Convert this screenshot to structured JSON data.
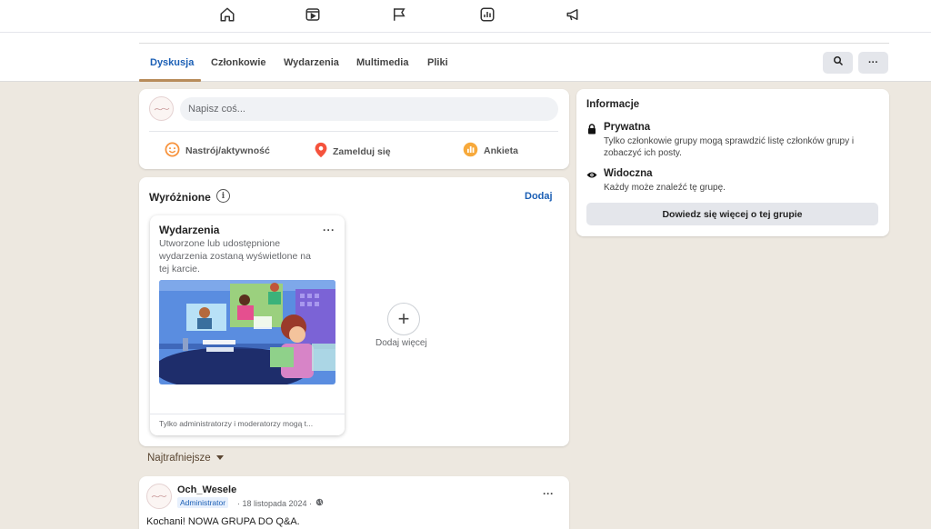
{
  "nav": {
    "icons": [
      "home-icon",
      "video-icon",
      "flag-icon",
      "chart-icon",
      "megaphone-icon"
    ]
  },
  "tabs": [
    {
      "label": "Dyskusja",
      "active": true
    },
    {
      "label": "Członkowie",
      "active": false
    },
    {
      "label": "Wydarzenia",
      "active": false
    },
    {
      "label": "Multimedia",
      "active": false
    },
    {
      "label": "Pliki",
      "active": false
    }
  ],
  "header_actions": {
    "search_icon": "search-icon",
    "more_label": "···"
  },
  "composer": {
    "placeholder": "Napisz coś...",
    "actions": [
      {
        "label": "Nastrój/aktywność",
        "icon": "smiley-icon",
        "color": "#f7923b"
      },
      {
        "label": "Zamelduj się",
        "icon": "location-pin-icon",
        "color": "#f5533d"
      },
      {
        "label": "Ankieta",
        "icon": "poll-icon",
        "color": "#f7b928"
      }
    ]
  },
  "featured": {
    "title": "Wyróżnione",
    "info_glyph": "i",
    "add_label": "Dodaj",
    "card": {
      "title": "Wydarzenia",
      "more_label": "···",
      "description": "Utworzone lub udostępnione wydarzenia zostaną wyświetlone na tej karcie.",
      "footer": "Tylko administratorzy i moderatorzy mogą t..."
    },
    "add_more_glyph": "+",
    "add_more_label": "Dodaj więcej"
  },
  "sort": {
    "label": "Najtrafniejsze"
  },
  "post": {
    "author": "Och_Wesele",
    "badge": "Administrator",
    "date": "· 18 listopada 2024 ·",
    "more_label": "···",
    "text": "Kochani! NOWA GRUPA DO Q&A."
  },
  "info": {
    "title": "Informacje",
    "items": [
      {
        "icon": "lock-icon",
        "title": "Prywatna",
        "description": "Tylko członkowie grupy mogą sprawdzić listę członków grupy i zobaczyć ich posty."
      },
      {
        "icon": "eye-icon",
        "title": "Widoczna",
        "description": "Każdy może znaleźć tę grupę."
      }
    ],
    "button_label": "Dowiedz się więcej o tej grupie"
  },
  "colors": {
    "accent": "#1b5fb5",
    "background": "#ede8e0",
    "tab_underline": "#b88c5a"
  }
}
